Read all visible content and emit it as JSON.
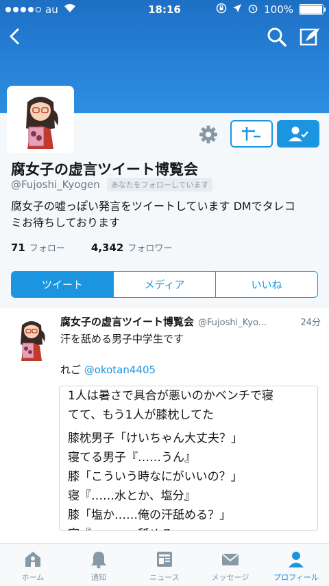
{
  "status_bar": {
    "carrier": "au",
    "time": "18:16",
    "battery": "100%",
    "battery_level": 1.0
  },
  "profile": {
    "name": "腐女子の虚言ツイート博覧会",
    "handle": "@Fujoshi_Kyogen",
    "follows_you": "あなたをフォローしています",
    "bio_line1": "腐女子の嘘っぽい発言をツイートしています DMでタレコ",
    "bio_line2": "ミお待ちしております",
    "following_count": "71",
    "following_label": "フォロー",
    "followers_count": "4,342",
    "followers_label": "フォロワー"
  },
  "tabs": [
    {
      "label": "ツイート",
      "active": true
    },
    {
      "label": "メディア",
      "active": false
    },
    {
      "label": "いいね",
      "active": false
    }
  ],
  "tweet": {
    "name": "腐女子の虚言ツイート博覧会",
    "handle": "@Fujoshi_Kyo...",
    "time": "24分",
    "text": "汗を舐める男子中学生です",
    "credit_prefix": "れご ",
    "credit_mention": "@okotan4405",
    "quote_lines": [
      "1人は暑さで具合が悪いのかベンチで寝",
      "てて、もう1人が膝枕してた",
      "膝枕男子「けいちゃん大丈夫？」",
      "寝てる男子『……うん』",
      "膝「こういう時なにがいいの？」",
      "寝『……水とか、塩分』",
      "膝「塩か……俺の汗舐める？」",
      "寝『…………舐める』"
    ]
  },
  "bottom_nav": [
    {
      "label": "ホーム",
      "icon": "home-icon",
      "active": false
    },
    {
      "label": "通知",
      "icon": "bell-icon",
      "active": false
    },
    {
      "label": "ニュース",
      "icon": "news-icon",
      "active": false
    },
    {
      "label": "メッセージ",
      "icon": "mail-icon",
      "active": false
    },
    {
      "label": "プロフィール",
      "icon": "person-icon",
      "active": true
    }
  ],
  "colors": {
    "accent": "#1b95e0",
    "header": "#2782d8",
    "muted": "#657786"
  }
}
